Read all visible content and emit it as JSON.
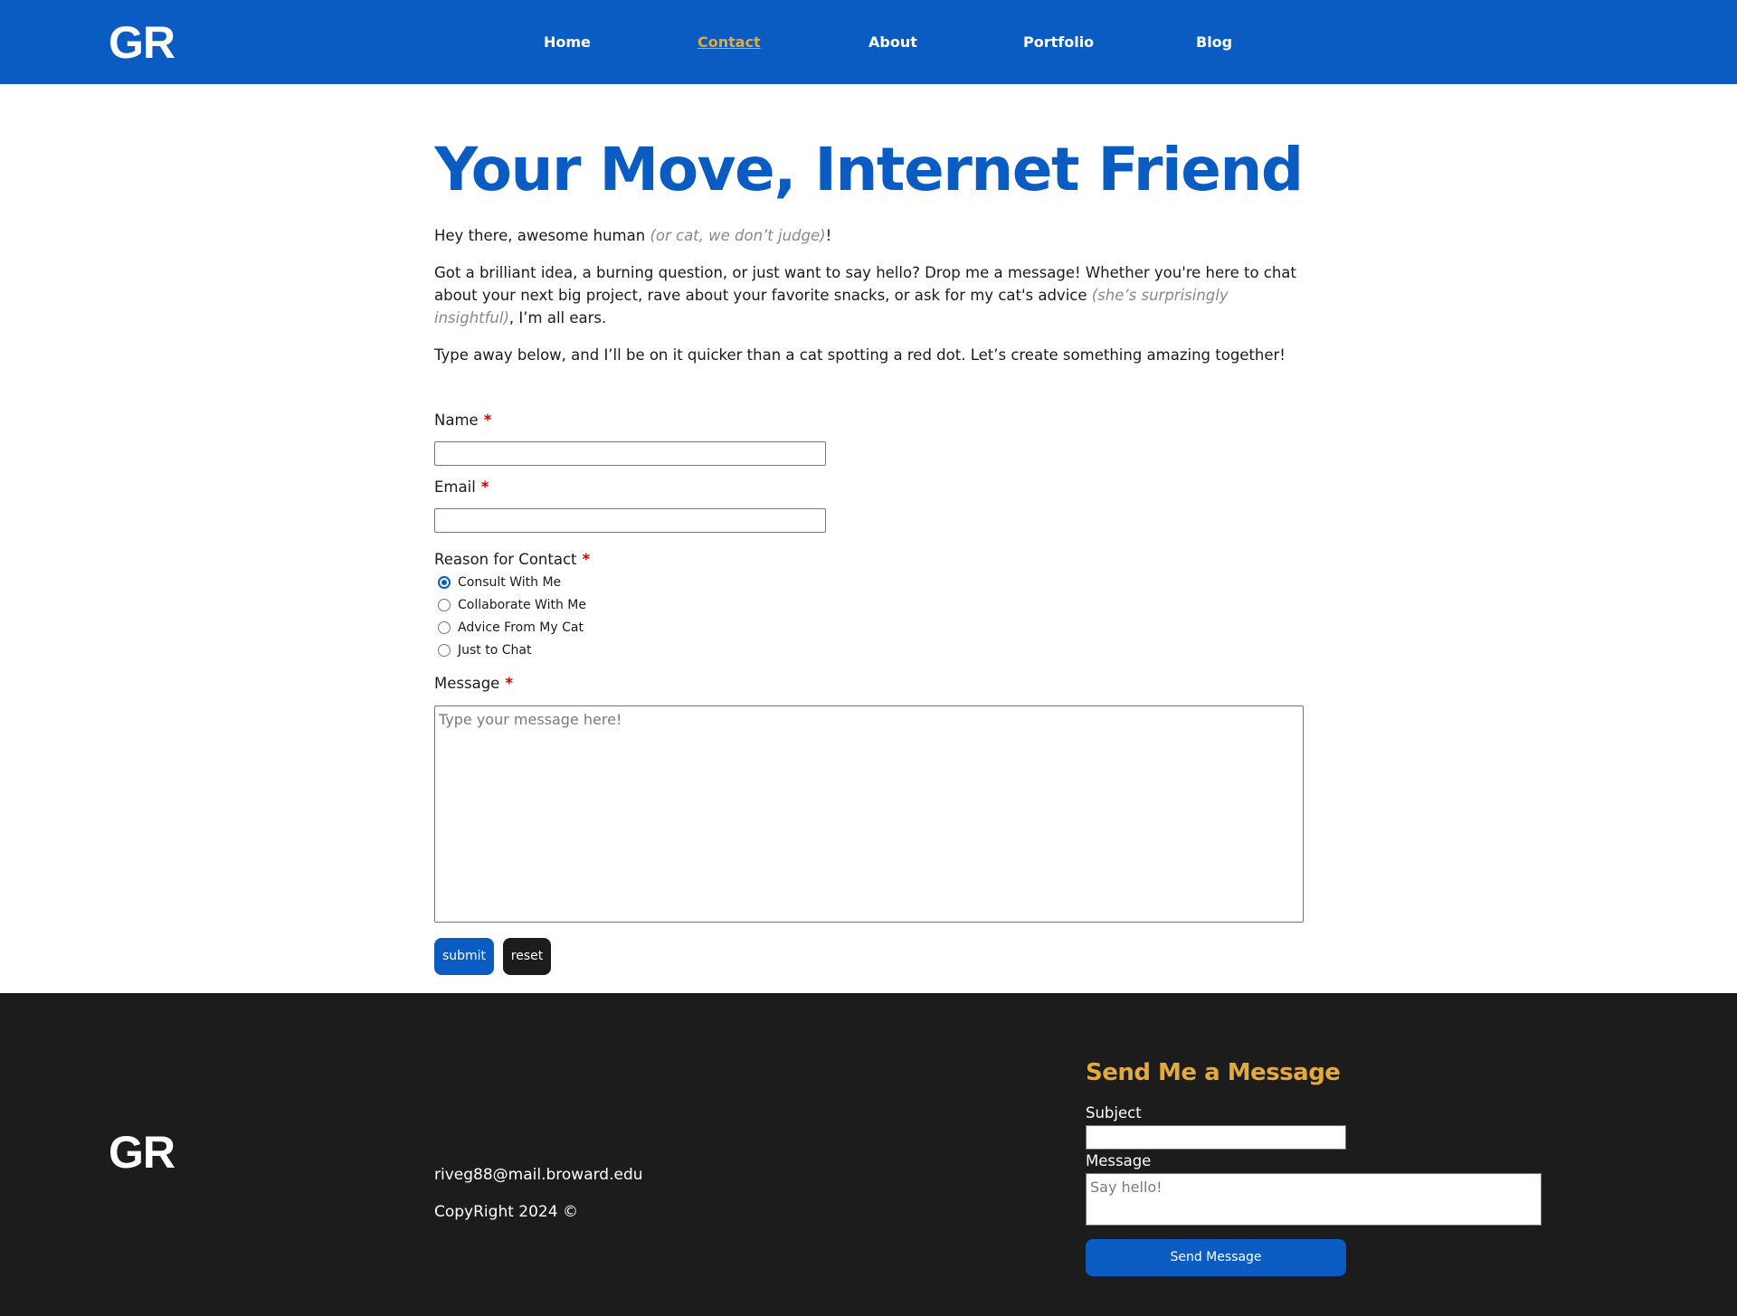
{
  "header": {
    "logo": "GR",
    "nav": [
      {
        "label": "Home"
      },
      {
        "label": "Contact"
      },
      {
        "label": "About"
      },
      {
        "label": "Portfolio"
      },
      {
        "label": "Blog"
      }
    ],
    "active_nav": "Contact"
  },
  "main": {
    "title": "Your Move, Internet Friend",
    "intro": {
      "greeting": "Hey there, awesome human ",
      "greeting_aside": "(or cat, we don’t judge)",
      "greeting_end": "!",
      "para2_start": "Got a brilliant idea, a burning question, or just want to say hello? Drop me a message! Whether you're here to chat about your next big project, rave about your favorite snacks, or ask for my cat's advice ",
      "para2_aside": "(she’s surprisingly insightful)",
      "para2_end": ", I’m all ears.",
      "para3": "Type away below, and I’ll be on it quicker than a cat spotting a red dot. Let’s create something amazing together!"
    },
    "form": {
      "name_label": "Name",
      "email_label": "Email",
      "reason_label": "Reason for Contact",
      "required_mark": "*",
      "reasons": [
        {
          "label": "Consult With Me",
          "checked": true
        },
        {
          "label": "Collaborate With Me",
          "checked": false
        },
        {
          "label": "Advice From My Cat",
          "checked": false
        },
        {
          "label": "Just to Chat",
          "checked": false
        }
      ],
      "message_label": "Message",
      "message_placeholder": "Type your message here!",
      "submit_label": "submit",
      "reset_label": "reset"
    }
  },
  "footer": {
    "logo": "GR",
    "email": "riveg88@mail.broward.edu",
    "copyright": "CopyRight 2024 ©",
    "form": {
      "heading": "Send Me a Message",
      "subject_label": "Subject",
      "message_label": "Message",
      "message_placeholder": "Say hello!",
      "send_label": "Send Message"
    }
  },
  "colors": {
    "brand_blue": "#0b5cc2",
    "accent_gold": "#e3a93a",
    "footer_bg": "#1c1c1c",
    "required_red": "#d10000"
  }
}
